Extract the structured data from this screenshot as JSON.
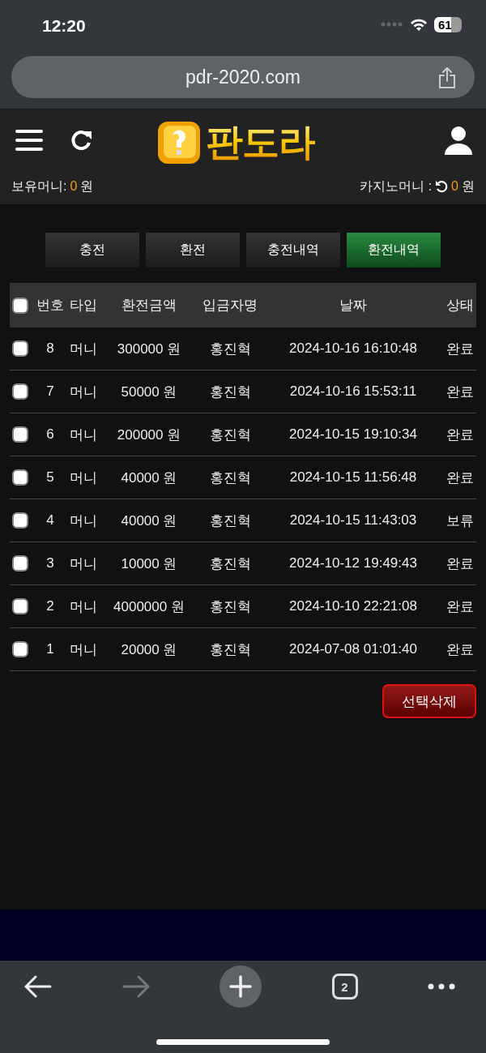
{
  "status_bar": {
    "time": "12:20",
    "battery": "61"
  },
  "browser": {
    "url": "pdr-2020.com",
    "tab_count": "2"
  },
  "header": {
    "logo_text": "판도라",
    "wallet_label": "보유머니:",
    "wallet_amount": "0",
    "wallet_unit": "원",
    "casino_label": "카지노머니 :",
    "casino_amount": "0",
    "casino_unit": "원"
  },
  "tabs": [
    {
      "label": "충전",
      "selected": false
    },
    {
      "label": "환전",
      "selected": false
    },
    {
      "label": "충전내역",
      "selected": false
    },
    {
      "label": "환전내역",
      "selected": true
    }
  ],
  "table": {
    "select_all_checked": false,
    "columns": [
      "번호",
      "타입",
      "환전금액",
      "입금자명",
      "날짜",
      "상태"
    ],
    "rows": [
      {
        "checked": false,
        "cells": [
          "8",
          "머니",
          "300000 원",
          "홍진혁",
          "2024-10-16 16:10:48",
          "완료"
        ]
      },
      {
        "checked": false,
        "cells": [
          "7",
          "머니",
          "50000 원",
          "홍진혁",
          "2024-10-16 15:53:11",
          "완료"
        ]
      },
      {
        "checked": false,
        "cells": [
          "6",
          "머니",
          "200000 원",
          "홍진혁",
          "2024-10-15 19:10:34",
          "완료"
        ]
      },
      {
        "checked": false,
        "cells": [
          "5",
          "머니",
          "40000 원",
          "홍진혁",
          "2024-10-15 11:56:48",
          "완료"
        ]
      },
      {
        "checked": false,
        "cells": [
          "4",
          "머니",
          "40000 원",
          "홍진혁",
          "2024-10-15 11:43:03",
          "보류"
        ]
      },
      {
        "checked": false,
        "cells": [
          "3",
          "머니",
          "10000 원",
          "홍진혁",
          "2024-10-12 19:49:43",
          "완료"
        ]
      },
      {
        "checked": false,
        "cells": [
          "2",
          "머니",
          "4000000 원",
          "홍진혁",
          "2024-10-10 22:21:08",
          "완료"
        ]
      },
      {
        "checked": false,
        "cells": [
          "1",
          "머니",
          "20000 원",
          "홍진혁",
          "2024-07-08 01:01:40",
          "완료"
        ]
      }
    ]
  },
  "delete_button": "선택삭제"
}
